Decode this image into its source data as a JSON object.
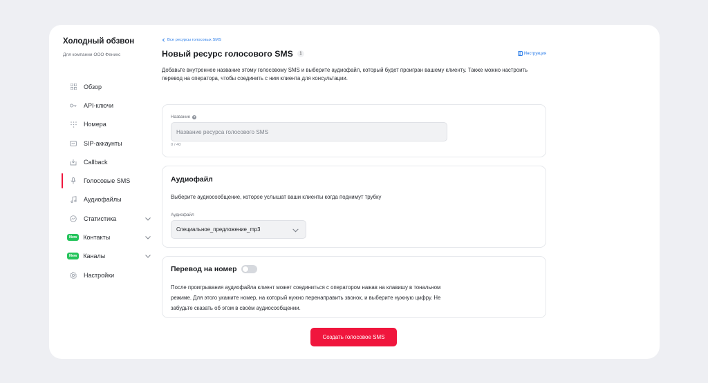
{
  "sidebar": {
    "title": "Холодный обзвон",
    "subtitle": "Для компании ООО Феникс",
    "items": [
      {
        "label": "Обзор",
        "icon": "grid-icon"
      },
      {
        "label": "API-ключи",
        "icon": "key-icon"
      },
      {
        "label": "Номера",
        "icon": "dialpad-icon"
      },
      {
        "label": "SIP-аккаунты",
        "icon": "sip-icon"
      },
      {
        "label": "Callback",
        "icon": "callback-icon"
      },
      {
        "label": "Голосовые SMS",
        "icon": "microphone-icon",
        "active": true
      },
      {
        "label": "Аудиофайлы",
        "icon": "music-note-icon"
      },
      {
        "label": "Статистика",
        "icon": "stats-icon"
      },
      {
        "label": "Контакты",
        "badge": "New"
      },
      {
        "label": "Каналы",
        "badge": "New"
      },
      {
        "label": "Настройки",
        "icon": "gear-icon"
      }
    ]
  },
  "main": {
    "back_link": "Все ресурсы голосовых SMS",
    "title": "Новый ресурс голосового SMS",
    "count": "1",
    "help_link": "Инструкция",
    "description": "Добавьте внутреннее название этому голосовому SMS и выберите аудиофайл, который будет проигран вашему клиенту. Также можно настроить перевод на оператора, чтобы соединить с ним клиента для консультации.",
    "name_section": {
      "label": "Название",
      "placeholder": "Название ресурса голосового SMS",
      "value": "",
      "counter": "0 / 40"
    },
    "audio_section": {
      "title": "Аудиофайл",
      "text": "Выберите аудиосообщение, которое услышат ваши клиенты когда поднимут трубку",
      "label": "Аудиофайл",
      "selected": "Специальное_предложение_mp3"
    },
    "transfer_section": {
      "title": "Перевод на номер",
      "toggle_on": false,
      "text": "После проигрывания аудиофайла клиент может соединиться с оператором нажав на клавишу в тональном режиме. Для этого укажите номер, на который нужно перенаправить звонок, и выберите нужную цифру. Не забудьте сказать об этом в своём аудиосообщении."
    },
    "submit_label": "Создать голосовое SMS"
  },
  "colors": {
    "accent": "#f0163d",
    "link": "#2b7de9",
    "new_badge": "#25c45c"
  }
}
